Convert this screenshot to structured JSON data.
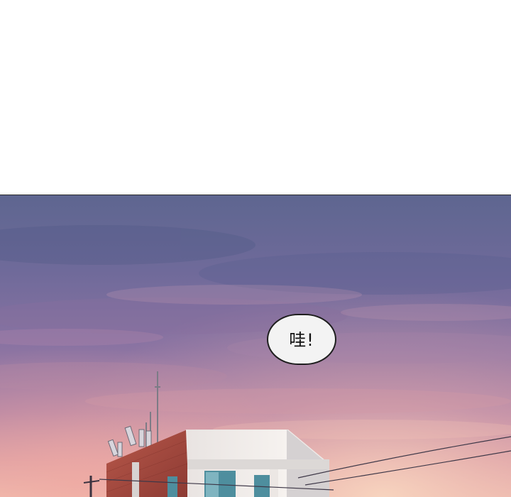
{
  "speech_bubble": {
    "text": "哇!"
  },
  "colors": {
    "sky_top": "#5a5f8e",
    "sky_mid": "#7d6e9e",
    "sky_glow": "#e9a9a6",
    "building_brick": "#a8483c",
    "building_wall": "#f1eeea",
    "bubble_fill": "#f3f3f3",
    "bubble_border": "#1e1e1e"
  }
}
